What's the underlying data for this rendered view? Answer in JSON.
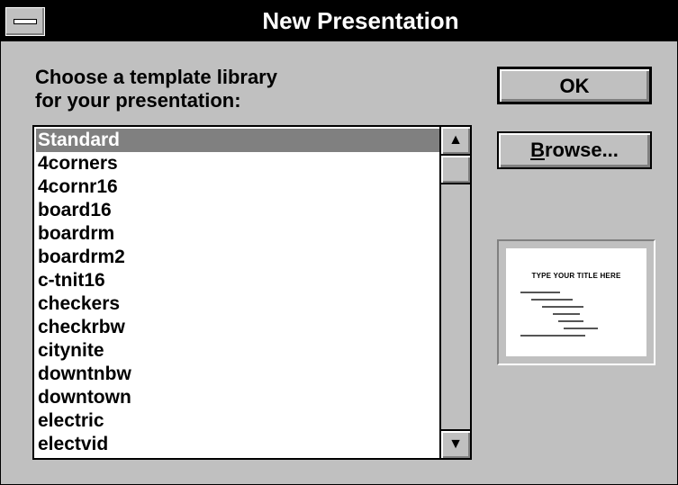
{
  "window": {
    "title": "New Presentation"
  },
  "prompt": "Choose a template library\nfor your presentation:",
  "buttons": {
    "ok": "OK",
    "browse_mnemonic": "B",
    "browse_rest": "rowse..."
  },
  "templates": {
    "selected_index": 0,
    "items": [
      "Standard",
      "4corners",
      "4cornr16",
      "board16",
      "boardrm",
      "boardrm2",
      "c-tnit16",
      "checkers",
      "checkrbw",
      "citynite",
      "downtnbw",
      "downtown",
      "electric",
      "electvid"
    ]
  },
  "scrollbar": {
    "up_glyph": "▲",
    "down_glyph": "▼"
  },
  "preview": {
    "title": "TYPE YOUR TITLE HERE"
  },
  "colors": {
    "selection": "#808080",
    "titlebar": "#000000",
    "face": "#c0c0c0"
  }
}
